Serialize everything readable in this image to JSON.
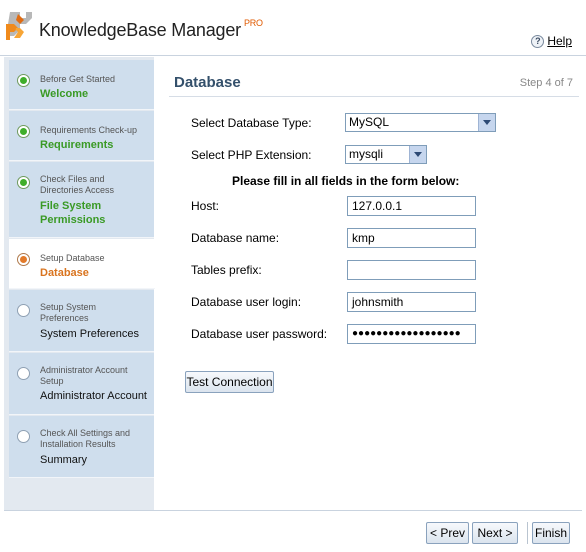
{
  "header": {
    "app_name": "KnowledgeBase Manager",
    "pro_badge": "PRO",
    "help_icon_glyph": "?",
    "help_label": "Help"
  },
  "sidebar": {
    "steps": [
      {
        "sub": "Before Get Started",
        "main": "Welcome",
        "status": "done"
      },
      {
        "sub": "Requirements Check-up",
        "main": "Requirements",
        "status": "done"
      },
      {
        "sub": "Check Files and Directories Access",
        "main": "File System Permissions",
        "status": "done"
      },
      {
        "sub": "Setup Database",
        "main": "Database",
        "status": "current"
      },
      {
        "sub": "Setup System Preferences",
        "main": "System Preferences",
        "status": "pending"
      },
      {
        "sub": "Administrator Account Setup",
        "main": "Administrator Account",
        "status": "pending"
      },
      {
        "sub": "Check All Settings and Installation Results",
        "main": "Summary",
        "status": "pending"
      }
    ]
  },
  "main": {
    "title": "Database",
    "step_counter": "Step 4 of 7",
    "db_type_label": "Select Database Type:",
    "db_type_value": "MySQL",
    "php_ext_label": "Select PHP Extension:",
    "php_ext_value": "mysqli",
    "instruction": "Please fill in all fields in the form below:",
    "host_label": "Host:",
    "host_value": "127.0.0.1",
    "db_name_label": "Database name:",
    "db_name_value": "kmp",
    "prefix_label": "Tables prefix:",
    "prefix_value": "",
    "user_login_label": "Database user login:",
    "user_login_value": "johnsmith",
    "user_password_label": "Database user password:",
    "user_password_value": "●●●●●●●●●●●●●●●●●●",
    "test_connection_label": "Test Connection"
  },
  "footer": {
    "prev_label": "< Prev",
    "next_label": "Next >",
    "finish_label": "Finish"
  },
  "colors": {
    "done": "#3fae2a",
    "current": "#e27a2a",
    "heading": "#34506b",
    "sidebar_bg": "#cfdeed"
  }
}
